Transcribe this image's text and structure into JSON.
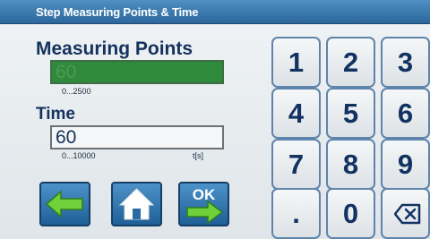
{
  "window": {
    "title": "Step Measuring Points & Time"
  },
  "measuring_points": {
    "label": "Measuring Points",
    "value": "60",
    "range": "0...2500"
  },
  "time": {
    "label": "Time",
    "value": "60",
    "range": "0...10000",
    "unit": "t[s]"
  },
  "nav": {
    "back_icon": "arrow-left-icon",
    "home_icon": "home-icon",
    "ok_label": "OK",
    "ok_icon": "arrow-right-icon"
  },
  "keypad": {
    "keys": [
      "1",
      "2",
      "3",
      "4",
      "5",
      "6",
      "7",
      "8",
      "9",
      ".",
      "0"
    ],
    "backspace_icon": "backspace-icon"
  },
  "colors": {
    "title_bar": "#3a7ab2",
    "label_text": "#14325c",
    "field_selected_bg": "#2f8a3c",
    "nav_button": "#2a6aa3",
    "keypad_border": "#5f84ab",
    "nav_arrow": "#6fd03a"
  }
}
